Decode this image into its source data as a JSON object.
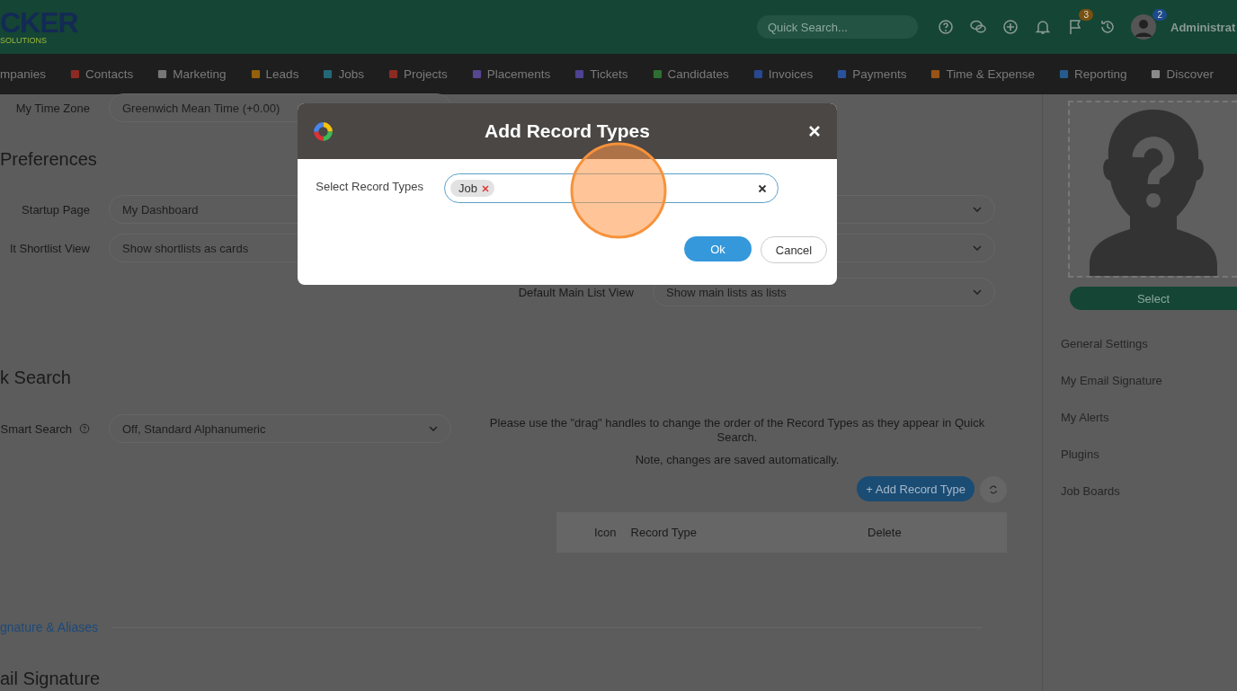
{
  "header": {
    "logo": "CKER",
    "logo_tagline": "SOLUTIONS",
    "search": {
      "placeholder": "Quick Search..."
    },
    "flag_badge": "3",
    "avatar_badge": "2",
    "user": "Administrat"
  },
  "nav": [
    {
      "label": "mpanies"
    },
    {
      "label": "Contacts",
      "color": "#8c2b22"
    },
    {
      "label": "Marketing",
      "color": "#777777"
    },
    {
      "label": "Leads",
      "color": "#94600c"
    },
    {
      "label": "Jobs",
      "color": "#236878"
    },
    {
      "label": "Projects",
      "color": "#8c2b22"
    },
    {
      "label": "Placements",
      "color": "#594690"
    },
    {
      "label": "Tickets",
      "color": "#4e4294"
    },
    {
      "label": "Candidates",
      "color": "#2f6e32"
    },
    {
      "label": "Invoices",
      "color": "#284890"
    },
    {
      "label": "Payments",
      "color": "#2a529a"
    },
    {
      "label": "Time & Expense",
      "color": "#985418"
    },
    {
      "label": "Reporting",
      "color": "#255c8c"
    },
    {
      "label": "Discover",
      "color": "#8a8a8a"
    }
  ],
  "time_zone": {
    "label": "My Time Zone",
    "value": "Greenwich Mean Time (+0.00)"
  },
  "preferences": {
    "heading": "Preferences",
    "fields": [
      {
        "label": "Startup Page",
        "value": "My Dashboard"
      },
      {
        "label": "lt Shortlist View",
        "value": "Show shortlists as cards"
      }
    ],
    "right_fields": [
      {
        "value_hidden": true
      },
      {
        "value_hidden": true
      },
      {
        "value_hidden": false,
        "label": "Default Main List View",
        "value": "Show main lists as lists"
      }
    ]
  },
  "quick_search": {
    "heading": "k Search",
    "smart_label": "Smart Search",
    "smart_value": "Off, Standard Alphanumeric",
    "note": "Please use the \"drag\" handles to change the order of the Record Types as they appear in Quick Search.",
    "note_2": "Note, changes are saved automatically.",
    "add_button": "+ Add Record Type",
    "columns": [
      "Icon",
      "Record Type",
      "Delete"
    ]
  },
  "signature_link": "gnature & Aliases",
  "signature_heading": "ail Signature",
  "sidebar": {
    "select_button": "Select",
    "links": [
      "General Settings",
      "My Email Signature",
      "My Alerts",
      "Plugins",
      "Job Boards"
    ]
  },
  "dialog": {
    "title": "Add Record Types",
    "label": "Select Record Types",
    "tags": [
      "Job"
    ],
    "ok": "Ok",
    "cancel": "Cancel"
  }
}
